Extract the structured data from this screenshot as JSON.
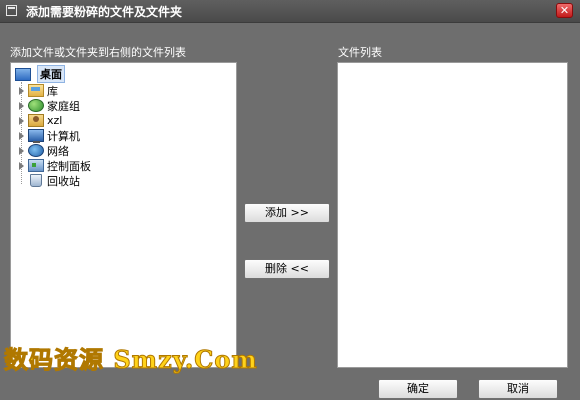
{
  "window": {
    "title": "添加需要粉碎的文件及文件夹",
    "close_glyph": "✕",
    "title_icon": "window-icon",
    "close_icon": "close-icon"
  },
  "left_panel": {
    "label": "添加文件或文件夹到右侧的文件列表",
    "tree": {
      "root": {
        "label": "桌面",
        "icon": "desktop-icon"
      },
      "items": [
        {
          "label": "库",
          "icon": "library-icon",
          "expandable": true
        },
        {
          "label": "家庭组",
          "icon": "homegroup-icon",
          "expandable": true
        },
        {
          "label": "xzl",
          "icon": "user-folder-icon",
          "expandable": true
        },
        {
          "label": "计算机",
          "icon": "computer-icon",
          "expandable": true
        },
        {
          "label": "网络",
          "icon": "network-icon",
          "expandable": true
        },
        {
          "label": "控制面板",
          "icon": "control-panel-icon",
          "expandable": true
        },
        {
          "label": "回收站",
          "icon": "recycle-bin-icon",
          "expandable": false
        }
      ]
    }
  },
  "right_panel": {
    "label": "文件列表",
    "items": []
  },
  "buttons": {
    "add": "添加 >>",
    "remove": "删除 <<",
    "ok": "确定",
    "cancel": "取消"
  },
  "watermark": {
    "text": "数码资源 Smzy.Com"
  },
  "colors": {
    "background": "#6e6e6e",
    "titlebar": "#4a4a4a",
    "close_button": "#c01a1a",
    "watermark": "#ffd21a"
  }
}
